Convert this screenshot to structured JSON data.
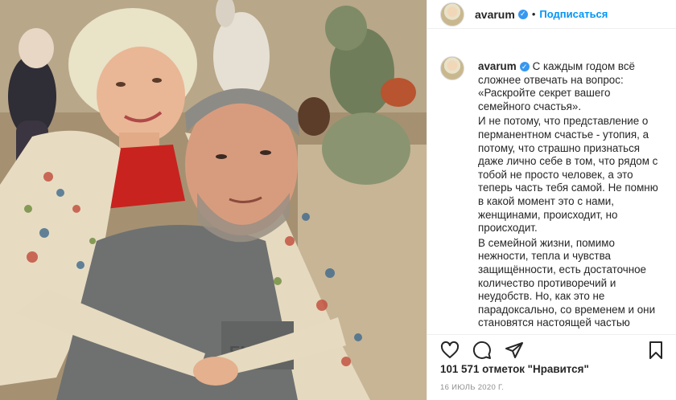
{
  "post": {
    "photo_alt": "",
    "header": {
      "username": "avarum",
      "separator": "•",
      "follow_label": "Подписаться"
    },
    "caption": {
      "username": "avarum",
      "paragraphs": [
        "С каждым годом всё сложнее отвечать на вопрос: «Раскройте секрет вашего семейного счастья».",
        "И не потому, что представление о перманентном счастье - утопия, а потому, что страшно признаться даже лично себе в том, что рядом с тобой не просто человек, а это теперь часть тебя самой. Не помню в какой момент это с нами, женщинами, происходит, но происходит.",
        "В семейной жизни, помимо нежности, тепла и чувства защищённости, есть достаточное количество противоречий и неудобств. Но, как это не парадоксально, со временем и они становятся настоящей частью"
      ]
    },
    "likes_text": "101 571 отметок \"Нравится\"",
    "date_text": "16 ИЮЛЬ 2020 Г.",
    "icons": {
      "like": "heart-icon",
      "comment": "comment-icon",
      "share": "paper-plane-icon",
      "save": "bookmark-icon",
      "verified": "verified-badge-icon"
    },
    "colors": {
      "follow": "#0095f6",
      "verified": "#3897f0",
      "meta_text": "#8e8e8e"
    }
  }
}
